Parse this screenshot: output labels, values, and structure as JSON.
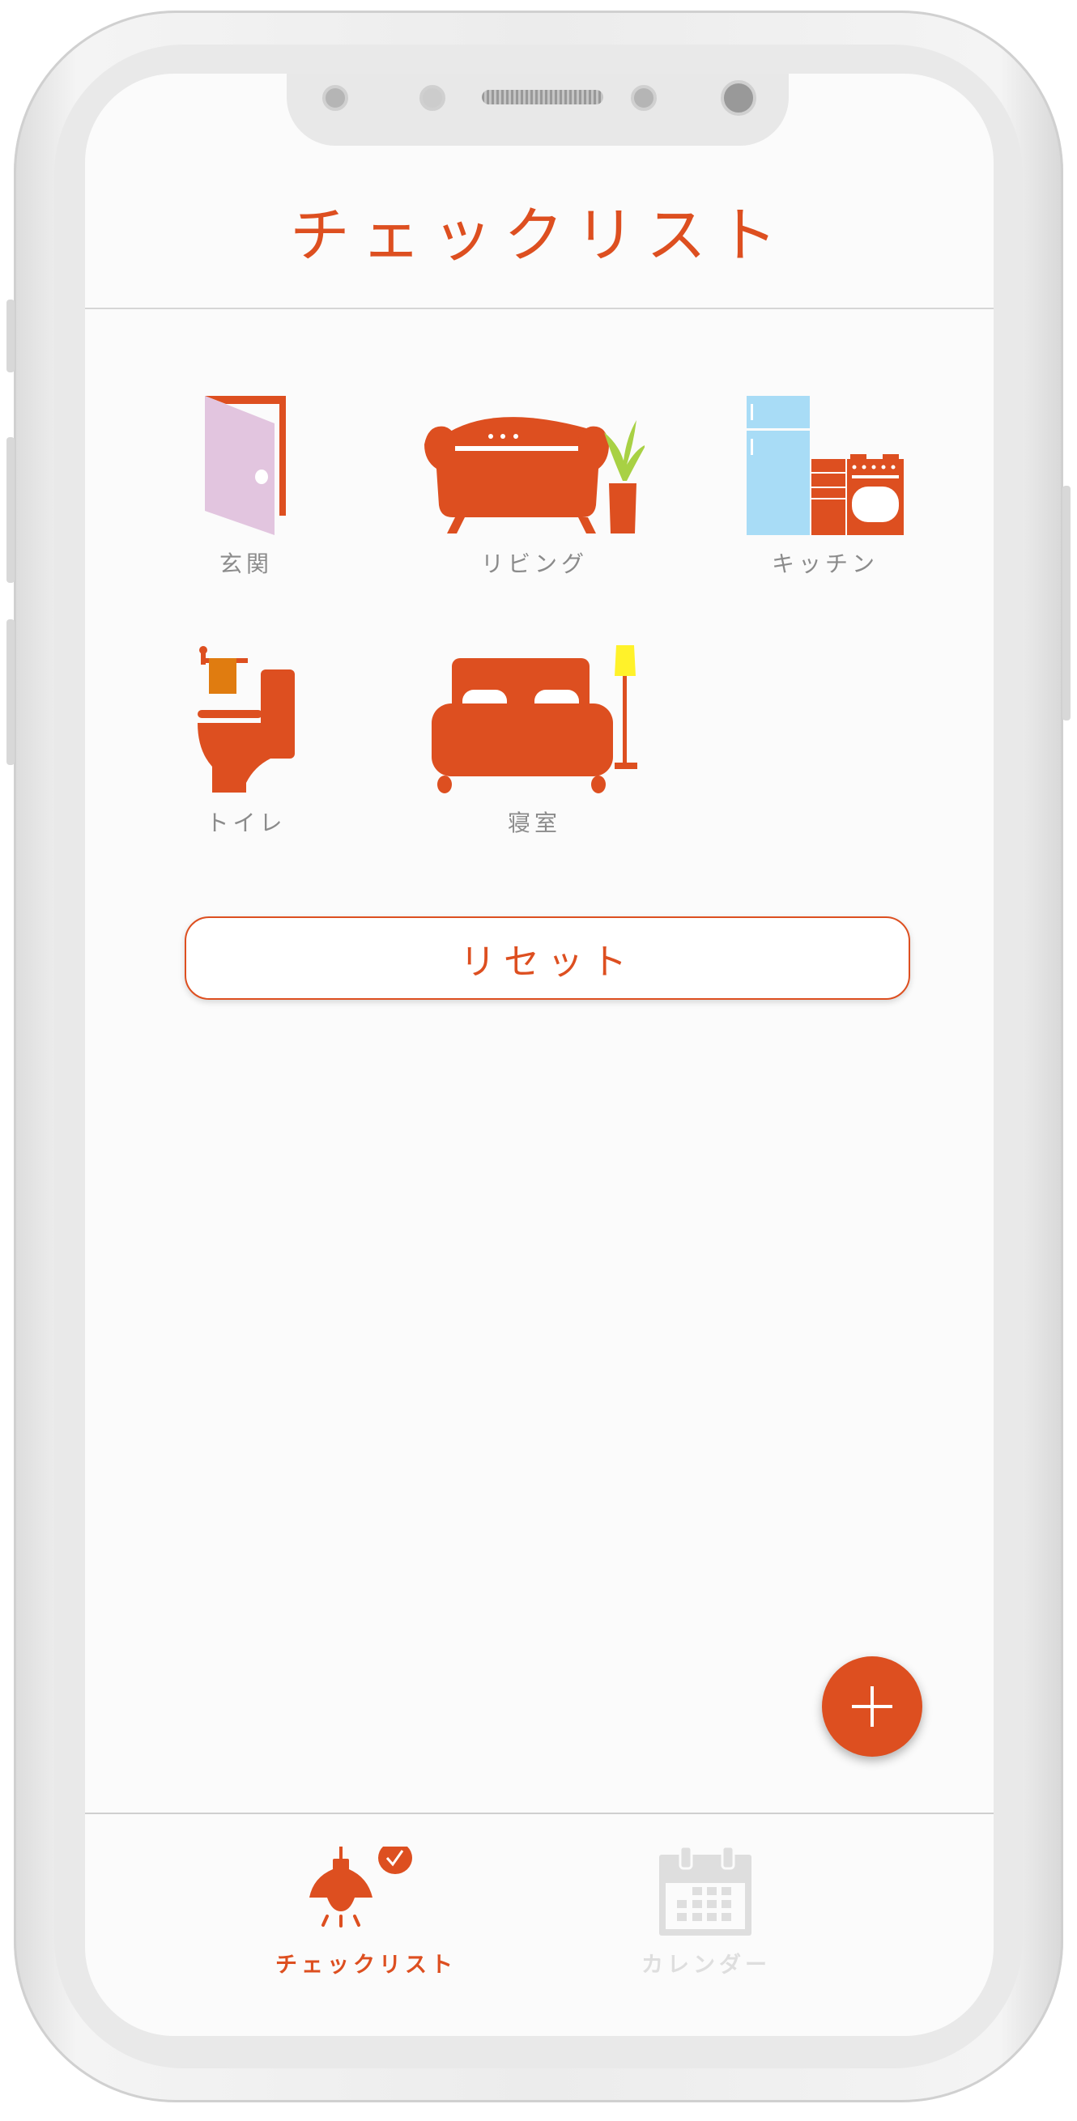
{
  "header": {
    "title": "チェックリスト"
  },
  "rooms": [
    {
      "label": "玄関",
      "icon": "door-icon"
    },
    {
      "label": "リビング",
      "icon": "sofa-icon"
    },
    {
      "label": "キッチン",
      "icon": "kitchen-icon"
    },
    {
      "label": "トイレ",
      "icon": "toilet-icon"
    },
    {
      "label": "寝室",
      "icon": "bed-icon"
    }
  ],
  "reset_label": "リセット",
  "fab": {
    "icon": "plus-icon"
  },
  "tabs": [
    {
      "label": "チェックリスト",
      "icon": "lamp-check-icon",
      "active": true
    },
    {
      "label": "カレンダー",
      "icon": "calendar-icon",
      "active": false
    }
  ],
  "colors": {
    "accent": "#dd4f20",
    "inactive": "#dedede",
    "label": "#8b8b8b"
  }
}
